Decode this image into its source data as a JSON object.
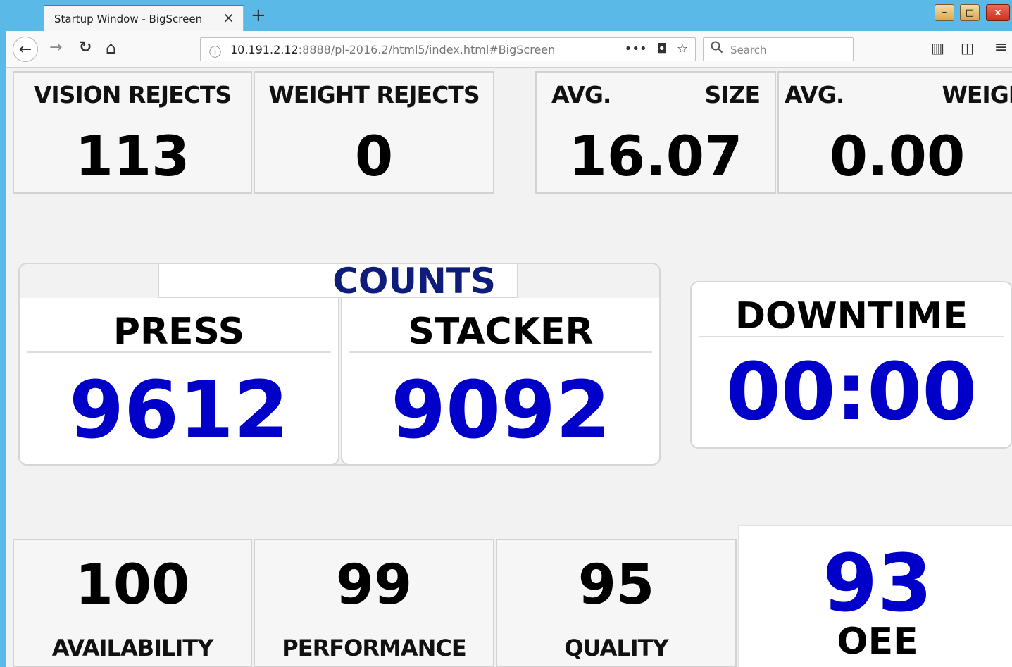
{
  "browser": {
    "tab_title": "Startup Window - BigScreen",
    "tab_close": "×",
    "new_tab": "+",
    "url_host": "10.191.2.12",
    "url_path": ":8888/pl-2016.2/html5/index.html#BigScreen",
    "search_placeholder": "Search",
    "icons": {
      "back": "←",
      "forward": "→",
      "reload": "↻",
      "home": "⌂",
      "info": "ⓘ",
      "more": "•••",
      "pocket": "◘",
      "bookmark": "☆",
      "library": "▥",
      "sidebar": "◫",
      "menu": "≡",
      "minimize": "–",
      "maximize": "□",
      "close": "x"
    }
  },
  "top_kpis": {
    "vision_rejects": {
      "label": "VISION REJECTS",
      "value": "113"
    },
    "weight_rejects": {
      "label": "WEIGHT REJECTS",
      "value": "0"
    },
    "avg_size": {
      "label_left": "AVG.",
      "label_right": "SIZE",
      "value": "16.07"
    },
    "avg_weight": {
      "label_left": "AVG.",
      "label_right": "WEIGHT",
      "value": "0.00"
    }
  },
  "counts": {
    "title": "COUNTS",
    "press": {
      "label": "PRESS",
      "value": "9612"
    },
    "stacker": {
      "label": "STACKER",
      "value": "9092"
    }
  },
  "downtime": {
    "label": "DOWNTIME",
    "value": "00:00"
  },
  "metrics": {
    "availability": {
      "label": "AVAILABILITY",
      "value": "100"
    },
    "performance": {
      "label": "PERFORMANCE",
      "value": "99"
    },
    "quality": {
      "label": "QUALITY",
      "value": "95"
    },
    "oee": {
      "label": "OEE",
      "value": "93"
    }
  },
  "colors": {
    "accent_blue": "#0000c8",
    "counts_title": "#0e1c7a",
    "window_frame": "#5ab9e6"
  }
}
